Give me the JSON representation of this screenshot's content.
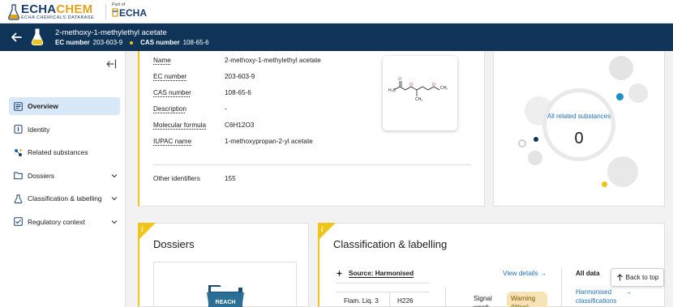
{
  "brand": {
    "wordmark_main": "ECHA",
    "wordmark_accent": "CHEM",
    "wordmark_sub": "ECHA CHEMICALS DATABASE",
    "partof_label": "Part of",
    "partof_name": "ECHA"
  },
  "substance": {
    "name": "2-methoxy-1-methylethyl acetate",
    "ec_label": "EC number",
    "ec_value": "203-603-9",
    "cas_label": "CAS number",
    "cas_value": "108-65-6"
  },
  "sidebar": {
    "items": [
      {
        "label": "Overview",
        "icon": "overview-icon",
        "active": true
      },
      {
        "label": "Identity",
        "icon": "identity-icon"
      },
      {
        "label": "Related substances",
        "icon": "related-icon"
      },
      {
        "label": "Dossiers",
        "icon": "folder-icon",
        "expandable": true
      },
      {
        "label": "Classification & labelling",
        "icon": "flask-icon",
        "expandable": true
      },
      {
        "label": "Regulatory context",
        "icon": "regulatory-icon",
        "expandable": true
      }
    ]
  },
  "overview": {
    "fields": [
      {
        "key": "Name",
        "value": "2-methoxy-1-methylethyl acetate"
      },
      {
        "key": "EC number",
        "value": "203-603-9"
      },
      {
        "key": "CAS number",
        "value": "108-65-6"
      },
      {
        "key": "Description",
        "value": "-"
      },
      {
        "key": "Molecular formula",
        "value": "C6H12O3"
      },
      {
        "key": "IUPAC name",
        "value": "1-methoxypropan-2-yl acetate"
      }
    ],
    "other_identifiers_label": "Other identifiers",
    "other_identifiers_value": "155"
  },
  "related": {
    "label": "All related substances",
    "count": "0"
  },
  "dossiers": {
    "title": "Dossiers",
    "folder_label": "REACH"
  },
  "classification": {
    "title": "Classification & labelling",
    "source_label": "Source: Harmonised",
    "view_details": "View details →",
    "all_data": "All data",
    "harmonised_link": "Harmonised classifications",
    "hazard_class": "Flam. Liq. 3",
    "hazard_code": "H226",
    "signal_word_label": "Signal word:",
    "signal_word_value": "Warning (Wng)"
  },
  "back_to_top": "Back to top",
  "colors": {
    "header_bg": "#0f3457",
    "accent_yellow": "#f0c419",
    "link_blue": "#1f6fb2",
    "active_nav_bg": "#d8e8f7"
  }
}
